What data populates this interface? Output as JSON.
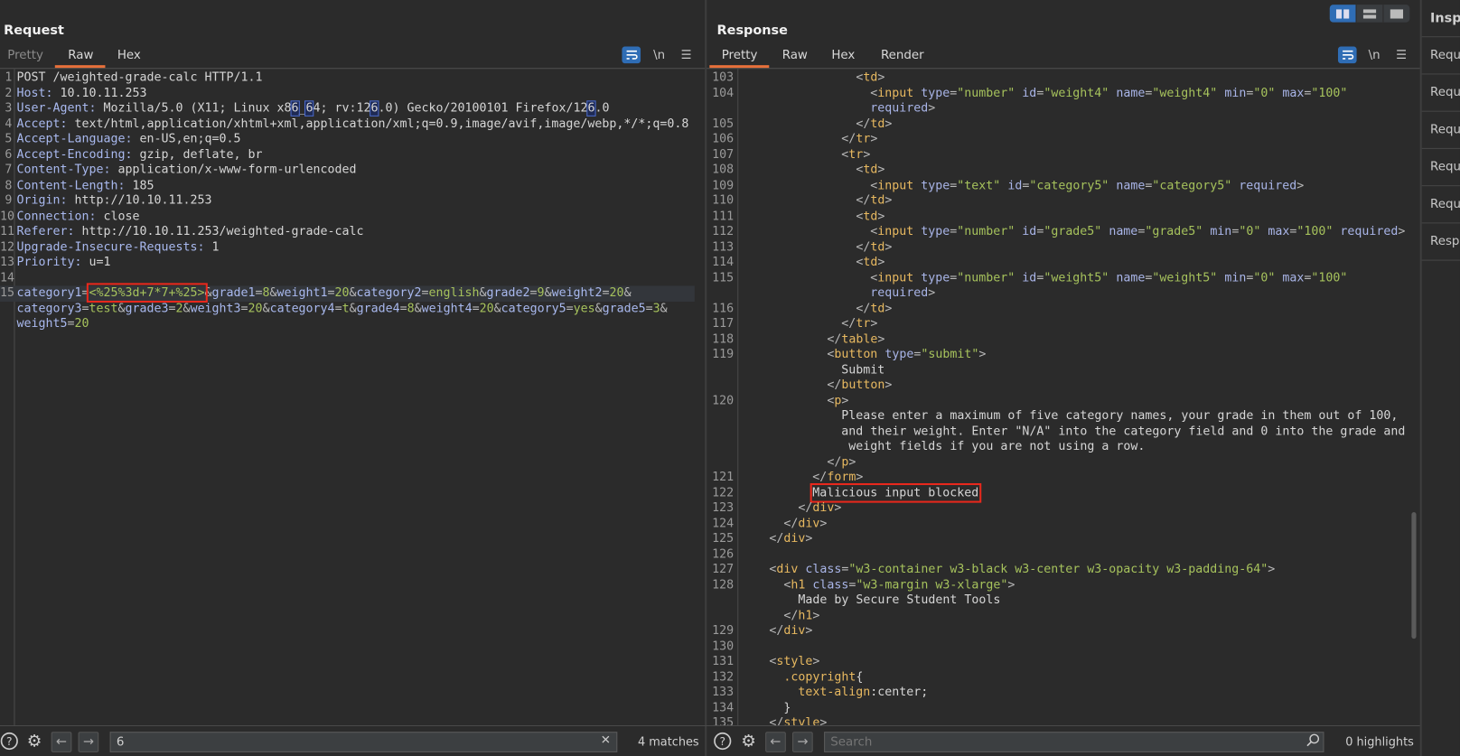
{
  "colors": {
    "accent": "#e8703a",
    "active_button": "#2f6db5",
    "highlight_box": "#e8281c"
  },
  "layout_buttons": [
    {
      "icon": "split-columns-icon",
      "active": true
    },
    {
      "icon": "split-rows-icon",
      "active": false
    },
    {
      "icon": "single-pane-icon",
      "active": false
    }
  ],
  "request": {
    "title": "Request",
    "tabs": [
      "Pretty",
      "Raw",
      "Hex"
    ],
    "active_tab": "Raw",
    "tools": {
      "wrap_icon": "word-wrap-icon",
      "newline_label": "\\n",
      "menu_icon": "hamburger-menu-icon"
    },
    "boxed": "<%25%3d+7*7+%25>",
    "current_line": "15",
    "lines": [
      {
        "n": "1",
        "kind": "start",
        "text": "POST /weighted-grade-calc HTTP/1.1"
      },
      {
        "n": "2",
        "kind": "header",
        "text": "Host: 10.10.11.253"
      },
      {
        "n": "3",
        "kind": "header",
        "text": "User-Agent: Mozilla/5.0 (X11; Linux x86_64; rv:126.0) Gecko/20100101 Firefox/126.0"
      },
      {
        "n": "4",
        "kind": "header",
        "text": "Accept: text/html,application/xhtml+xml,application/xml;q=0.9,image/avif,image/webp,*/*;q=0.8"
      },
      {
        "n": "5",
        "kind": "header",
        "text": "Accept-Language: en-US,en;q=0.5"
      },
      {
        "n": "6",
        "kind": "header",
        "text": "Accept-Encoding: gzip, deflate, br"
      },
      {
        "n": "7",
        "kind": "header",
        "text": "Content-Type: application/x-www-form-urlencoded"
      },
      {
        "n": "8",
        "kind": "header",
        "text": "Content-Length: 185"
      },
      {
        "n": "9",
        "kind": "header",
        "text": "Origin: http://10.10.11.253"
      },
      {
        "n": "10",
        "kind": "header",
        "text": "Connection: close"
      },
      {
        "n": "11",
        "kind": "header",
        "text": "Referer: http://10.10.11.253/weighted-grade-calc"
      },
      {
        "n": "12",
        "kind": "header",
        "text": "Upgrade-Insecure-Requests: 1"
      },
      {
        "n": "13",
        "kind": "header",
        "text": "Priority: u=1"
      },
      {
        "n": "14",
        "kind": "start",
        "text": ""
      },
      {
        "n": "15",
        "kind": "body",
        "text": "category1=<%25%3d+7*7+%25>&grade1=8&weight1=20&category2=english&grade2=9&weight2=20&"
      },
      {
        "n": "",
        "kind": "body",
        "text": "category3=test&grade3=2&weight3=20&category4=t&grade4=8&weight4=20&category5=yes&grade5=3&"
      },
      {
        "n": "",
        "kind": "body",
        "text": "weight5=20"
      }
    ],
    "search": {
      "value": "6",
      "matches": "4 matches"
    }
  },
  "response": {
    "title": "Response",
    "tabs": [
      "Pretty",
      "Raw",
      "Hex",
      "Render"
    ],
    "active_tab": "Pretty",
    "tools": {
      "wrap_icon": "word-wrap-icon",
      "newline_label": "\\n",
      "menu_icon": "hamburger-menu-icon"
    },
    "lines": [
      {
        "n": "103",
        "text": "                <td>"
      },
      {
        "n": "104",
        "text": "                  <input type=\"number\" id=\"weight4\" name=\"weight4\" min=\"0\" max=\"100\""
      },
      {
        "n": "",
        "text": "                  required>",
        "cont": true
      },
      {
        "n": "105",
        "text": "                </td>"
      },
      {
        "n": "106",
        "text": "              </tr>"
      },
      {
        "n": "107",
        "text": "              <tr>"
      },
      {
        "n": "108",
        "text": "                <td>"
      },
      {
        "n": "109",
        "text": "                  <input type=\"text\" id=\"category5\" name=\"category5\" required>"
      },
      {
        "n": "110",
        "text": "                </td>"
      },
      {
        "n": "111",
        "text": "                <td>"
      },
      {
        "n": "112",
        "text": "                  <input type=\"number\" id=\"grade5\" name=\"grade5\" min=\"0\" max=\"100\" required>"
      },
      {
        "n": "113",
        "text": "                </td>"
      },
      {
        "n": "114",
        "text": "                <td>"
      },
      {
        "n": "115",
        "text": "                  <input type=\"number\" id=\"weight5\" name=\"weight5\" min=\"0\" max=\"100\""
      },
      {
        "n": "",
        "text": "                  required>",
        "cont": true
      },
      {
        "n": "116",
        "text": "                </td>"
      },
      {
        "n": "117",
        "text": "              </tr>"
      },
      {
        "n": "118",
        "text": "            </table>"
      },
      {
        "n": "119",
        "text": "            <button type=\"submit\">"
      },
      {
        "n": "",
        "text": "              Submit"
      },
      {
        "n": "",
        "text": "            </button>"
      },
      {
        "n": "120",
        "text": "            <p>"
      },
      {
        "n": "",
        "text": "              Please enter a maximum of five category names, your grade in them out of 100,"
      },
      {
        "n": "",
        "text": "              and their weight. Enter \"N/A\" into the category field and 0 into the grade and"
      },
      {
        "n": "",
        "text": "               weight fields if you are not using a row."
      },
      {
        "n": "",
        "text": "            </p>"
      },
      {
        "n": "121",
        "text": "          </form>"
      },
      {
        "n": "122",
        "text": "          Malicious input blocked",
        "box": true
      },
      {
        "n": "123",
        "text": "        </div>"
      },
      {
        "n": "124",
        "text": "      </div>"
      },
      {
        "n": "125",
        "text": "    </div>"
      },
      {
        "n": "126",
        "text": ""
      },
      {
        "n": "127",
        "text": "    <div class=\"w3-container w3-black w3-center w3-opacity w3-padding-64\">"
      },
      {
        "n": "128",
        "text": "      <h1 class=\"w3-margin w3-xlarge\">"
      },
      {
        "n": "",
        "text": "        Made by Secure Student Tools"
      },
      {
        "n": "",
        "text": "      </h1>"
      },
      {
        "n": "129",
        "text": "    </div>"
      },
      {
        "n": "130",
        "text": ""
      },
      {
        "n": "131",
        "text": "    <style>"
      },
      {
        "n": "132",
        "text": "      .copyright{",
        "css": true
      },
      {
        "n": "133",
        "text": "        text-align:center;",
        "css": true
      },
      {
        "n": "134",
        "text": "      }",
        "css": true
      },
      {
        "n": "135",
        "text": "    </style>"
      }
    ],
    "search": {
      "placeholder": "Search",
      "value": "",
      "highlights": "0 highlights"
    }
  },
  "inspector": {
    "title": "Insp",
    "rows": [
      "Reque",
      "Reque",
      "Reque",
      "Reque",
      "Reque",
      "Respo"
    ]
  }
}
